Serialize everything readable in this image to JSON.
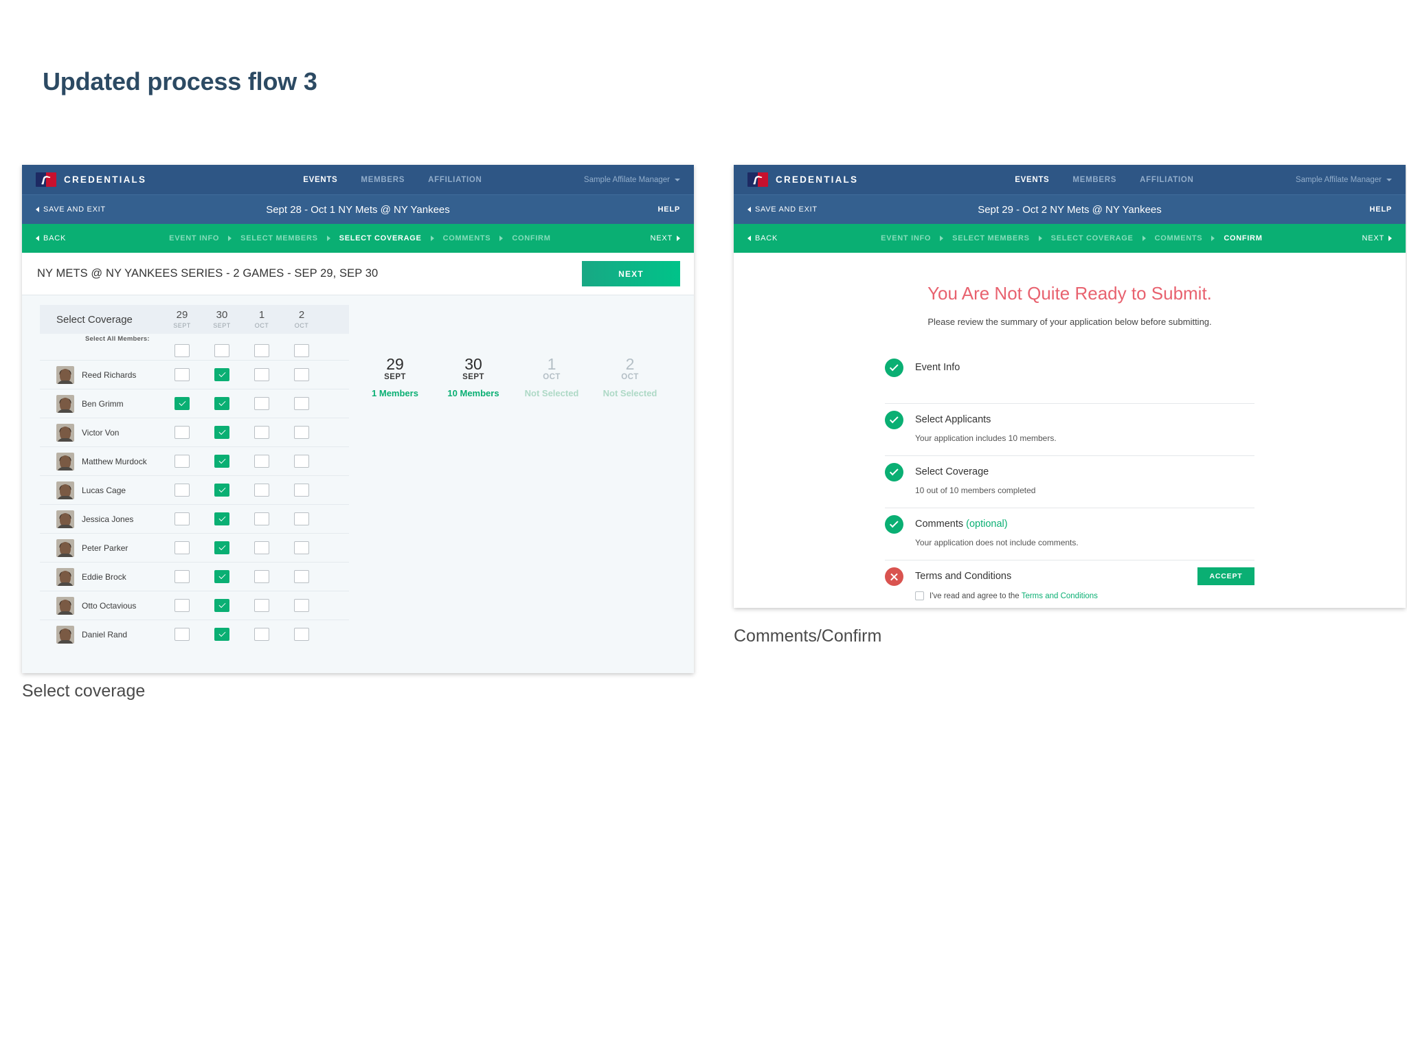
{
  "page": {
    "title": "Updated process flow 3",
    "title_color": "#2c4a63"
  },
  "colors": {
    "brand_blue": "#2e5685",
    "sub_blue": "#34608f",
    "green": "#0aaf73",
    "red": "#e8626f",
    "error_red": "#d9534f"
  },
  "screens": [
    {
      "caption": "Select coverage",
      "appbar": {
        "logo_icon": "mlb-logo-icon",
        "brand": "CREDENTIALS",
        "nav": [
          {
            "label": "EVENTS",
            "active": true
          },
          {
            "label": "MEMBERS",
            "active": false
          },
          {
            "label": "AFFILIATION",
            "active": false
          }
        ],
        "user": "Sample Affilate Manager",
        "user_caret_icon": "chevron-down-icon"
      },
      "eventbar": {
        "save_exit": "SAVE AND EXIT",
        "back_icon": "triangle-left-icon",
        "event_name": "Sept 28 - Oct 1 NY Mets @ NY Yankees",
        "help": "HELP"
      },
      "stepbar": {
        "back": "BACK",
        "next": "NEXT",
        "back_icon": "triangle-left-icon",
        "next_icon": "triangle-right-icon",
        "steps": [
          {
            "label": "EVENT INFO",
            "current": false
          },
          {
            "label": "SELECT MEMBERS",
            "current": false
          },
          {
            "label": "SELECT COVERAGE",
            "current": true
          },
          {
            "label": "COMMENTS",
            "current": false
          },
          {
            "label": "CONFIRM",
            "current": false
          }
        ]
      },
      "series_title": "NY METS @ NY YANKEES SERIES - 2 GAMES - SEP 29, SEP 30",
      "next_button": "NEXT",
      "coverage": {
        "header_label": "Select Coverage",
        "select_all_label": "Select All Members:",
        "columns": [
          {
            "day": "29",
            "month": "SEPT"
          },
          {
            "day": "30",
            "month": "SEPT"
          },
          {
            "day": "1",
            "month": "OCT"
          },
          {
            "day": "2",
            "month": "OCT"
          }
        ],
        "select_all": [
          false,
          false,
          false,
          false
        ],
        "members": [
          {
            "name": "Reed Richards",
            "avatar": "member-avatar",
            "checks": [
              false,
              true,
              false,
              false
            ]
          },
          {
            "name": "Ben Grimm",
            "avatar": "member-avatar",
            "checks": [
              true,
              true,
              false,
              false
            ]
          },
          {
            "name": "Victor Von",
            "avatar": "member-avatar",
            "checks": [
              false,
              true,
              false,
              false
            ]
          },
          {
            "name": "Matthew Murdock",
            "avatar": "member-avatar",
            "checks": [
              false,
              true,
              false,
              false
            ]
          },
          {
            "name": "Lucas Cage",
            "avatar": "member-avatar",
            "checks": [
              false,
              true,
              false,
              false
            ]
          },
          {
            "name": "Jessica Jones",
            "avatar": "member-avatar",
            "checks": [
              false,
              true,
              false,
              false
            ]
          },
          {
            "name": "Peter Parker",
            "avatar": "member-avatar",
            "checks": [
              false,
              true,
              false,
              false
            ]
          },
          {
            "name": "Eddie Brock",
            "avatar": "member-avatar",
            "checks": [
              false,
              true,
              false,
              false
            ]
          },
          {
            "name": "Otto Octavious",
            "avatar": "member-avatar",
            "checks": [
              false,
              true,
              false,
              false
            ]
          },
          {
            "name": "Daniel Rand",
            "avatar": "member-avatar",
            "checks": [
              false,
              true,
              false,
              false
            ]
          }
        ],
        "summary": [
          {
            "day": "29",
            "month": "SEPT",
            "status": "1 Members",
            "selected": true
          },
          {
            "day": "30",
            "month": "SEPT",
            "status": "10 Members",
            "selected": true
          },
          {
            "day": "1",
            "month": "OCT",
            "status": "Not Selected",
            "selected": false
          },
          {
            "day": "2",
            "month": "OCT",
            "status": "Not Selected",
            "selected": false
          }
        ]
      }
    },
    {
      "caption": "Comments/Confirm",
      "appbar": {
        "logo_icon": "mlb-logo-icon",
        "brand": "CREDENTIALS",
        "nav": [
          {
            "label": "EVENTS",
            "active": true
          },
          {
            "label": "MEMBERS",
            "active": false
          },
          {
            "label": "AFFILIATION",
            "active": false
          }
        ],
        "user": "Sample Affilate Manager",
        "user_caret_icon": "chevron-down-icon"
      },
      "eventbar": {
        "save_exit": "SAVE AND EXIT",
        "back_icon": "triangle-left-icon",
        "event_name": "Sept 29 - Oct 2 NY Mets @ NY Yankees",
        "help": "HELP"
      },
      "stepbar": {
        "back": "BACK",
        "next": "NEXT",
        "back_icon": "triangle-left-icon",
        "next_icon": "triangle-right-icon",
        "steps": [
          {
            "label": "EVENT INFO",
            "current": false
          },
          {
            "label": "SELECT MEMBERS",
            "current": false
          },
          {
            "label": "SELECT COVERAGE",
            "current": false
          },
          {
            "label": "COMMENTS",
            "current": false
          },
          {
            "label": "CONFIRM",
            "current": true
          }
        ]
      },
      "confirm": {
        "heading": "You Are Not Quite Ready to Submit.",
        "subheading": "Please review the summary of your application below before submitting.",
        "items": [
          {
            "title": "Event Info",
            "desc": "",
            "status": "ok",
            "status_icon": "check-circle-icon"
          },
          {
            "title": "Select Applicants",
            "desc": "Your application includes 10 members.",
            "status": "ok",
            "status_icon": "check-circle-icon"
          },
          {
            "title": "Select Coverage",
            "desc": "10 out of 10 members completed",
            "status": "ok",
            "status_icon": "check-circle-icon"
          },
          {
            "title": "Comments ",
            "optional": "(optional)",
            "desc": "Your application does not include comments.",
            "status": "ok",
            "status_icon": "check-circle-icon"
          },
          {
            "title": "Terms and Conditions",
            "desc": "",
            "status": "bad",
            "status_icon": "x-circle-icon"
          }
        ],
        "accept_button": "ACCEPT",
        "tc_checkbox_checked": false,
        "tc_text_prefix": "I've read and agree to the ",
        "tc_link": "Terms and Conditions"
      }
    }
  ]
}
